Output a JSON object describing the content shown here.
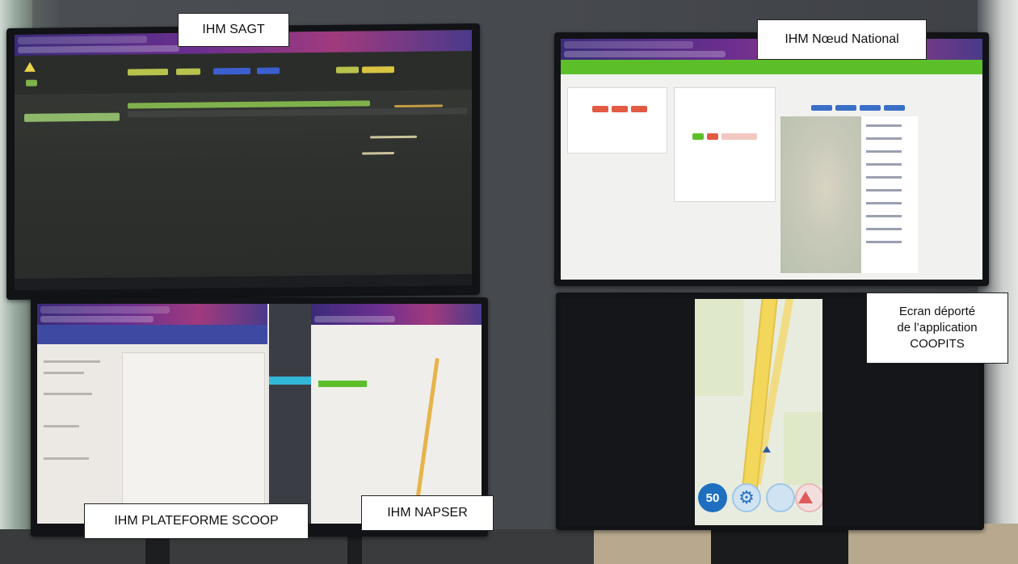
{
  "labels": {
    "sagt": "IHM SAGT",
    "noeud": "IHM Nœud  National",
    "coopits_line1": "Ecran déporté",
    "coopits_line2": "de l’application",
    "coopits_line3": "COOPITS",
    "scoop": "IHM PLATEFORME SCOOP",
    "napser": "IHM NAPSER"
  },
  "coopits_app": {
    "speed_limit": "50"
  },
  "colors": {
    "sagt_bg": "#2f312e",
    "noeud_green": "#5cbf2a",
    "scoop_header": "#3e49a1",
    "napser_accent": "#31b7d8",
    "speed_circle": "#1f6fc0"
  },
  "icons": [
    "warning-icon",
    "gear-icon",
    "target-icon",
    "hazard-triangle-icon",
    "navigation-arrow-icon"
  ]
}
